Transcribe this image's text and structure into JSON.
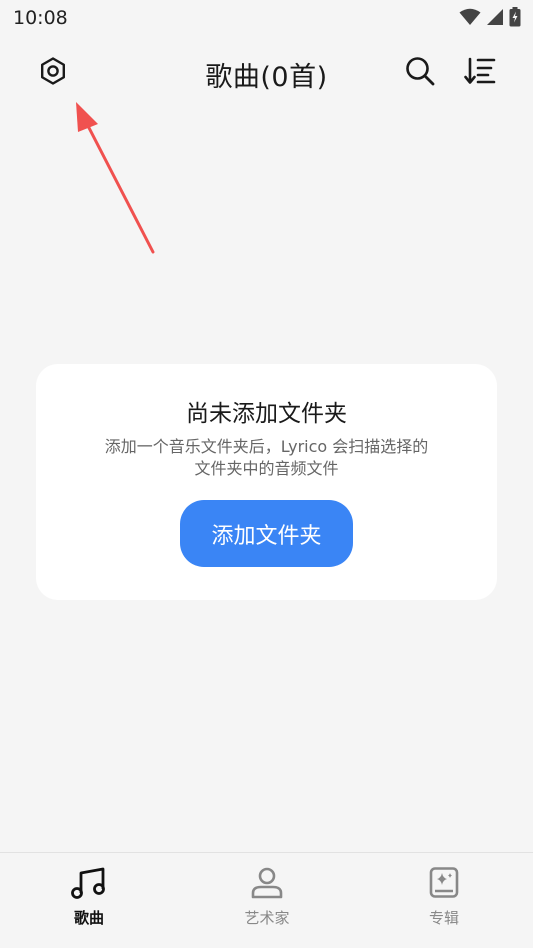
{
  "status_bar": {
    "time": "10:08",
    "icons": [
      "wifi-icon",
      "signal-icon",
      "battery-charging-icon"
    ]
  },
  "app_bar": {
    "title": "歌曲(0首)",
    "icons": [
      "settings-icon",
      "search-icon",
      "sort-icon"
    ]
  },
  "empty_state": {
    "title": "尚未添加文件夹",
    "description_line1": "添加一个音乐文件夹后，Lyrico 会扫描选择的",
    "description_line2": "文件夹中的音频文件",
    "button_label": "添加文件夹"
  },
  "bottom_nav": {
    "items": [
      {
        "label": "歌曲",
        "icon": "music-note-icon",
        "active": true
      },
      {
        "label": "艺术家",
        "icon": "person-icon",
        "active": false
      },
      {
        "label": "专辑",
        "icon": "album-sparkle-icon",
        "active": false
      }
    ]
  },
  "colors": {
    "accent": "#3a85f5",
    "annotation_arrow": "#f0514f",
    "background": "#f5f5f5",
    "card": "#ffffff"
  }
}
